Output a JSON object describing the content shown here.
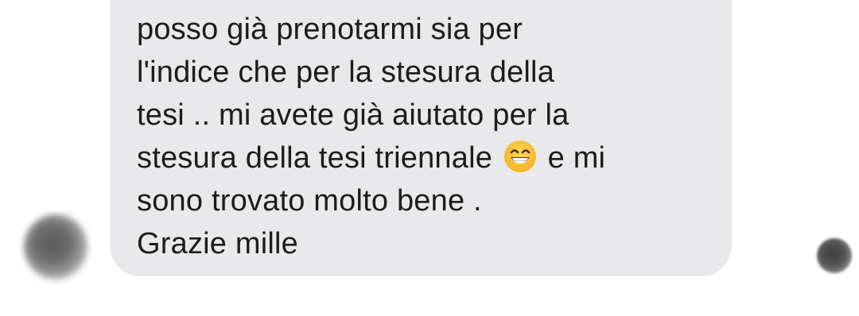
{
  "conversation": {
    "message": {
      "lines": [
        "posso già prenotarmi sia per",
        "l'indice che per la stesura della",
        "tesi .. mi avete già aiutato per la",
        "stesura della tesi triennale",
        "e mi",
        "sono trovato molto bene .",
        "Grazie mille"
      ],
      "emoji": "grinning-face-with-smiling-eyes"
    },
    "colors": {
      "bubble_background": "#e9e9eb",
      "text": "#1c1c1c",
      "emoji_face": "#f6c23b"
    }
  }
}
